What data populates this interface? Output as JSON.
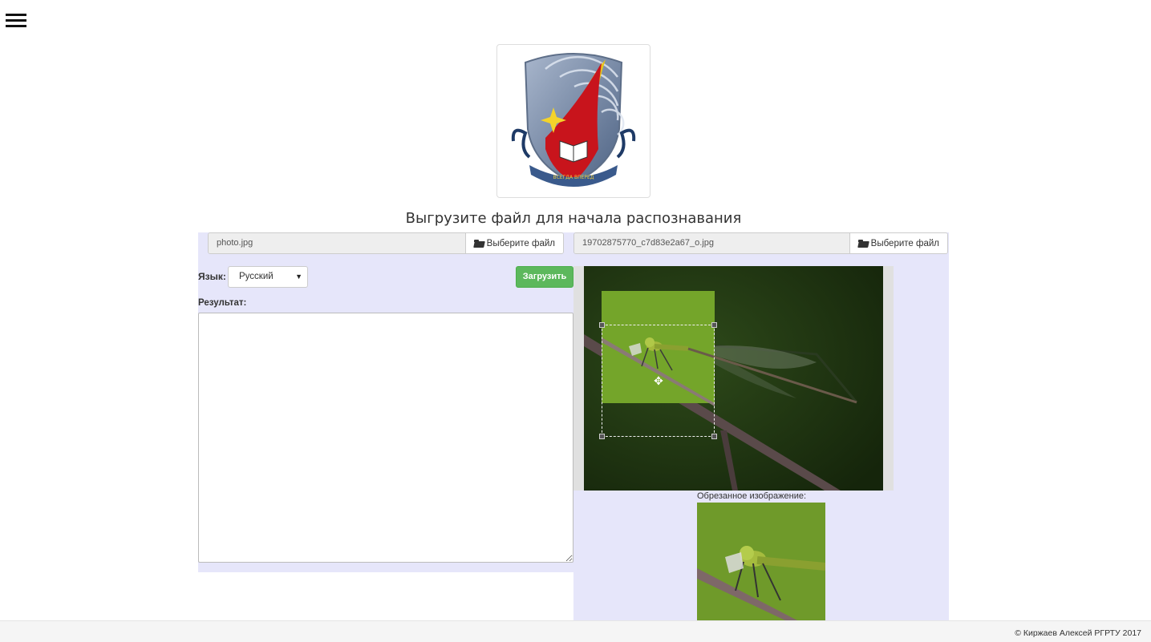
{
  "nav": {
    "menu_icon": "hamburger-icon"
  },
  "logo": {
    "motto": "ВСЕГДА ВПЕРЕД"
  },
  "heading": "Выгрузите файл для начала распознавания",
  "left_panel": {
    "file_name": "photo.jpg",
    "choose_file_label": "Выберите файл",
    "language_label": "Язык:",
    "language_value": "Русский",
    "upload_label": "Загрузить",
    "result_label": "Результат:",
    "result_text": ""
  },
  "right_panel": {
    "file_name": "19702875770_c7d83e2a67_o.jpg",
    "choose_file_label": "Выберите файл",
    "cropped_label": "Обрезанное изображение:"
  },
  "colors": {
    "panel_bg": "#e6e6fa",
    "upload_green": "#5cb85c"
  },
  "footer": {
    "text": "© Киржаев Алексей РГРТУ 2017"
  }
}
